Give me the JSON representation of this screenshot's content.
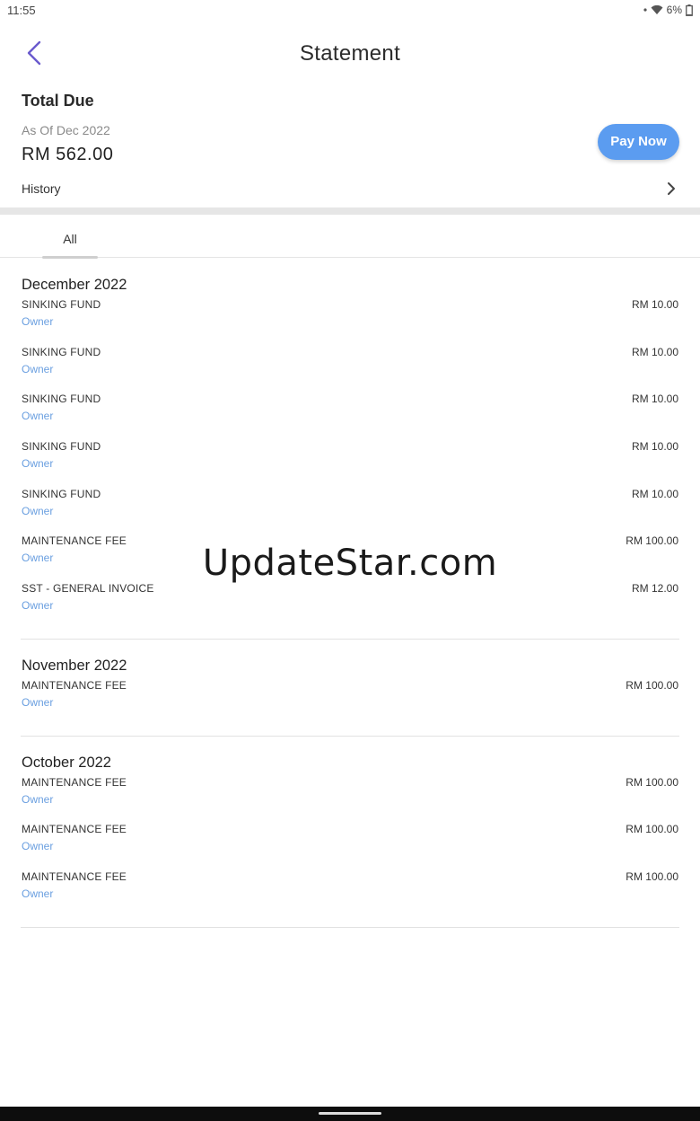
{
  "status_bar": {
    "time": "11:55",
    "battery": "6%"
  },
  "header": {
    "title": "Statement"
  },
  "due": {
    "title": "Total Due",
    "as_of": "As Of Dec 2022",
    "amount": "RM 562.00",
    "pay_button": "Pay Now",
    "history_label": "History"
  },
  "tabs": [
    {
      "label": "All"
    }
  ],
  "watermark": "UpdateStar.com",
  "colors": {
    "accent": "#5b9cf0",
    "role_text": "#6a9fe0",
    "back_arrow": "#6a5acd"
  },
  "sections": [
    {
      "title": "December 2022",
      "items": [
        {
          "name": "SINKING FUND",
          "role": "Owner",
          "amount": "RM 10.00"
        },
        {
          "name": "SINKING FUND",
          "role": "Owner",
          "amount": "RM 10.00"
        },
        {
          "name": "SINKING FUND",
          "role": "Owner",
          "amount": "RM 10.00"
        },
        {
          "name": "SINKING FUND",
          "role": "Owner",
          "amount": "RM 10.00"
        },
        {
          "name": "SINKING FUND",
          "role": "Owner",
          "amount": "RM 10.00"
        },
        {
          "name": "MAINTENANCE FEE",
          "role": "Owner",
          "amount": "RM 100.00"
        },
        {
          "name": "SST - GENERAL INVOICE",
          "role": "Owner",
          "amount": "RM 12.00"
        }
      ]
    },
    {
      "title": "November 2022",
      "items": [
        {
          "name": "MAINTENANCE FEE",
          "role": "Owner",
          "amount": "RM 100.00"
        }
      ]
    },
    {
      "title": "October 2022",
      "items": [
        {
          "name": "MAINTENANCE FEE",
          "role": "Owner",
          "amount": "RM 100.00"
        },
        {
          "name": "MAINTENANCE FEE",
          "role": "Owner",
          "amount": "RM 100.00"
        },
        {
          "name": "MAINTENANCE FEE",
          "role": "Owner",
          "amount": "RM 100.00"
        }
      ]
    }
  ]
}
